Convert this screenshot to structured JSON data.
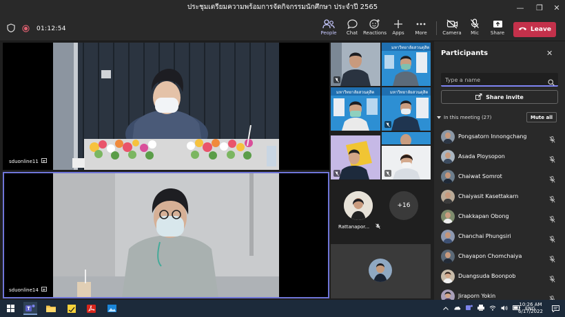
{
  "window": {
    "title": "ประชุมเตรียมความพร้อมการจัดกิจกรรมนักศึกษา ประจำปี 2565"
  },
  "toolbar": {
    "timer": "01:12:54",
    "people": "People",
    "chat": "Chat",
    "reactions": "Reactions",
    "apps": "Apps",
    "more": "More",
    "camera": "Camera",
    "mic": "Mic",
    "share": "Share",
    "leave": "Leave"
  },
  "stage": {
    "tile1_name": "sduonline11",
    "tile2_name": "sduonline14",
    "gallery_person_name": "Rattanapor...",
    "overflow_count": "+16",
    "banner_text": "มหาวิทยาลัยสวนดุสิต"
  },
  "panel": {
    "title": "Participants",
    "search_placeholder": "Type a name",
    "share_invite": "Share invite",
    "in_meeting": "In this meeting (27)",
    "mute_all": "Mute all",
    "participants": [
      "Pongsatorn Innongchang",
      "Asada Ploysopon",
      "Chaiwat Somrot",
      "Chaiyasit Kasettakarn",
      "Chakkapan Obong",
      "Chanchai Phungsiri",
      "Chayapon Chomchaiya",
      "Duangsuda Boonpob",
      "Jiraporn Yokin"
    ]
  },
  "taskbar": {
    "lang": "ENG",
    "time": "10:26 AM",
    "date": "6/17/2022"
  },
  "colors": {
    "accent": "#7f85f5",
    "leave": "#c4314b",
    "panel_bg": "#292929",
    "stage_bg": "#1f1f1f"
  }
}
